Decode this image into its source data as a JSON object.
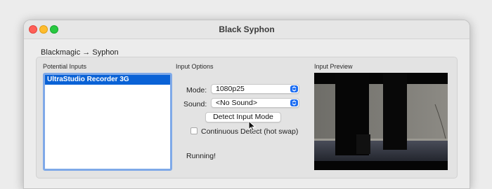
{
  "window": {
    "title": "Black Syphon"
  },
  "group": {
    "title": "Blackmagic → Syphon"
  },
  "inputs": {
    "label": "Potential Inputs",
    "items": [
      {
        "label": "UltraStudio Recorder 3G",
        "selected": true
      }
    ]
  },
  "options": {
    "label": "Input Options",
    "mode_label": "Mode:",
    "mode_value": "1080p25",
    "sound_label": "Sound:",
    "sound_value": "<No Sound>",
    "detect_button": "Detect Input Mode",
    "continuous_label": "Continuous Detect (hot swap)",
    "continuous_checked": false,
    "status": "Running!"
  },
  "preview": {
    "label": "Input Preview"
  },
  "colors": {
    "selection": "#0a62d6",
    "accent": "#1b6cf2",
    "close": "#ff5f57",
    "minimize": "#febc2e",
    "zoom": "#28c840"
  },
  "icons": {
    "close": "close-button",
    "minimize": "minimize-button",
    "zoom": "zoom-button",
    "popup": "chevron-up-down-icon",
    "cursor": "arrow-cursor-icon"
  }
}
